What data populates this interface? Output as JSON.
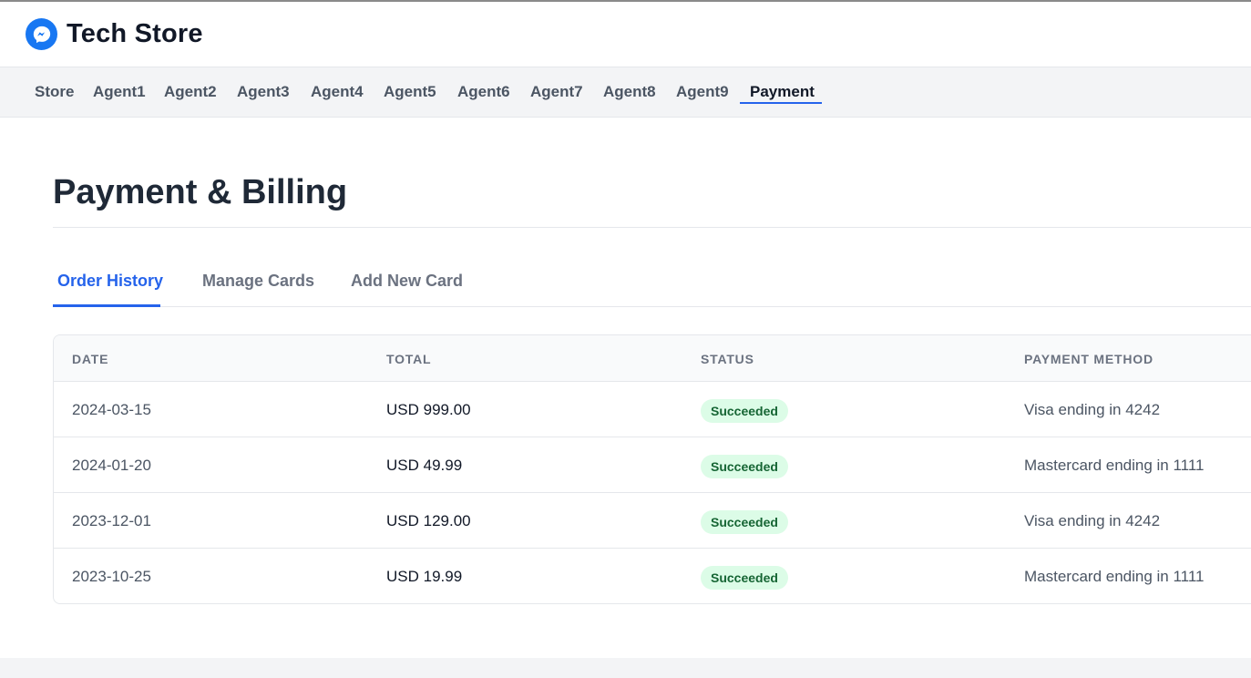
{
  "header": {
    "title": "Tech Store",
    "logo_icon": "messenger-icon"
  },
  "nav": {
    "items": [
      "Store",
      "Agent1",
      "Agent2",
      "Agent3",
      "Agent4",
      "Agent5",
      "Agent6",
      "Agent7",
      "Agent8",
      "Agent9",
      "Payment"
    ],
    "active": "Payment"
  },
  "page": {
    "title": "Payment & Billing"
  },
  "tabs": {
    "items": [
      "Order History",
      "Manage Cards",
      "Add New Card"
    ],
    "active": "Order History"
  },
  "table": {
    "columns": [
      "DATE",
      "TOTAL",
      "STATUS",
      "PAYMENT METHOD"
    ],
    "rows": [
      {
        "date": "2024-03-15",
        "total": "USD 999.00",
        "status": "Succeeded",
        "method": "Visa ending in 4242"
      },
      {
        "date": "2024-01-20",
        "total": "USD 49.99",
        "status": "Succeeded",
        "method": "Mastercard ending in 1111"
      },
      {
        "date": "2023-12-01",
        "total": "USD 129.00",
        "status": "Succeeded",
        "method": "Visa ending in 4242"
      },
      {
        "date": "2023-10-25",
        "total": "USD 19.99",
        "status": "Succeeded",
        "method": "Mastercard ending in 1111"
      }
    ]
  },
  "colors": {
    "accent": "#2563eb",
    "brand_logo": "#1877f2",
    "success_bg": "#dcfce7",
    "success_text": "#166534"
  }
}
